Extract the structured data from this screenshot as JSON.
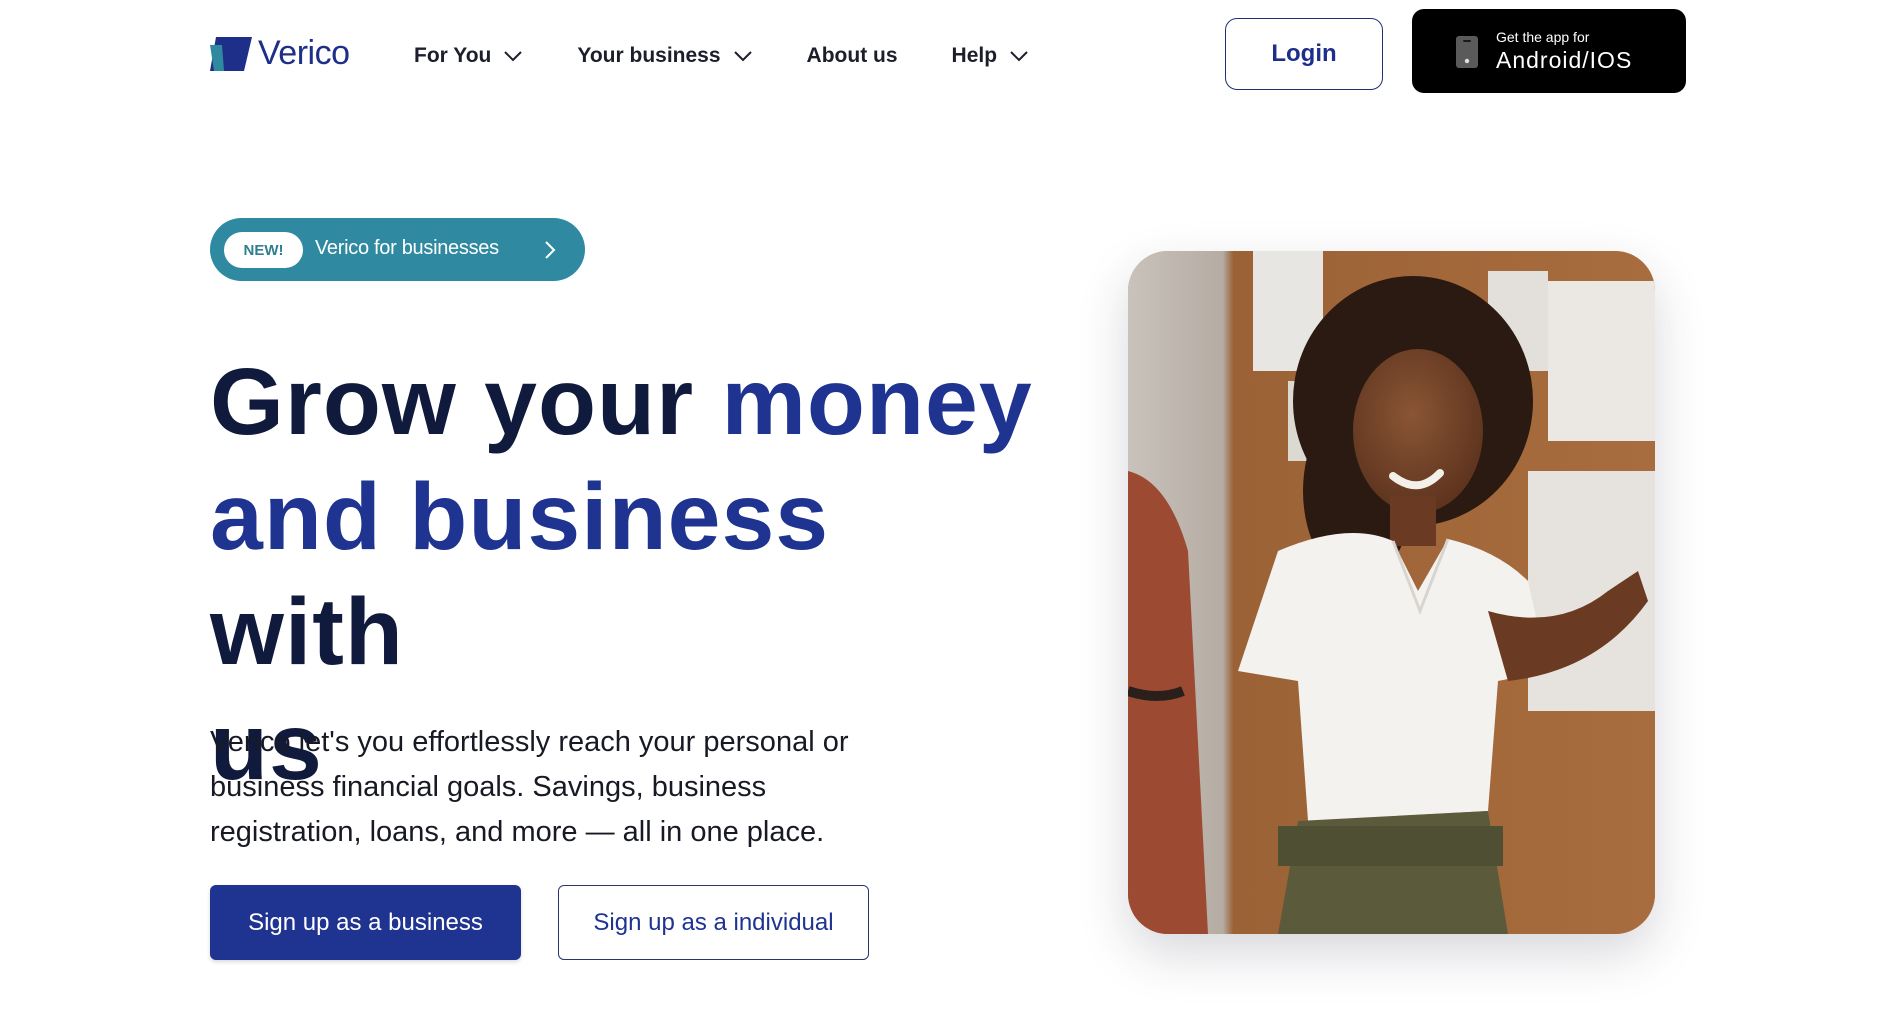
{
  "brand": {
    "name": "Verico"
  },
  "nav": {
    "items": [
      {
        "label": "For You",
        "has_dropdown": true
      },
      {
        "label": "Your business",
        "has_dropdown": true
      },
      {
        "label": "About us",
        "has_dropdown": false
      },
      {
        "label": "Help",
        "has_dropdown": true
      }
    ]
  },
  "header": {
    "login_label": "Login",
    "app_small": "Get the app for",
    "app_big": "Android/IOS"
  },
  "hero": {
    "badge": "NEW!",
    "pill_text": "Verico for businesses",
    "headline": {
      "part1": "Grow your ",
      "part2": "money",
      "part3": "and business",
      "part4": " with",
      "part5": "us"
    },
    "lead": "Verico let's you effortlessly reach your personal or business financial goals. Savings, business registration, loans, and more — all in one place.",
    "primary_button": "Sign up as a business",
    "secondary_button": "Sign up as a individual"
  },
  "colors": {
    "brand_blue": "#1f3391",
    "navy_text": "#0f1a3c",
    "teal_pill": "#2f8aa1",
    "black_button": "#000000"
  },
  "icons": [
    "verico-logo-icon",
    "chevron-down-icon",
    "phone-icon",
    "chevron-right-icon"
  ]
}
